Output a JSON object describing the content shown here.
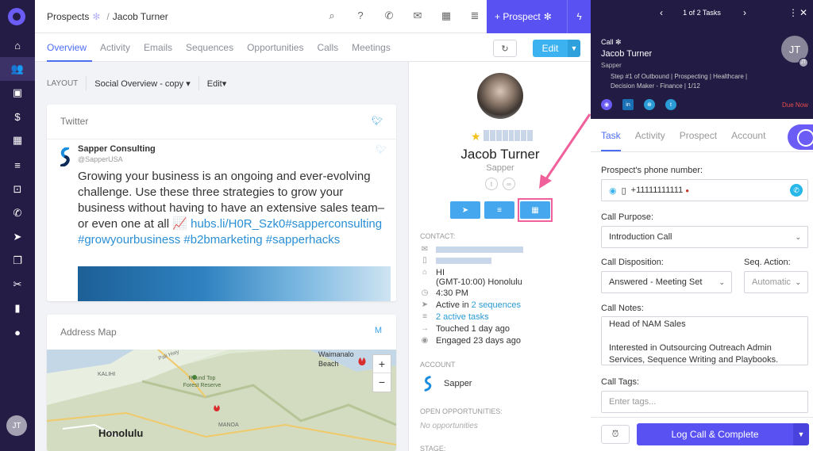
{
  "nav": {
    "avatar_initials": "JT",
    "icons": [
      "home-icon",
      "people-icon",
      "briefcase-icon",
      "dollar-icon",
      "calendar-icon",
      "tasks-icon",
      "inbox-icon",
      "phone-icon",
      "send-icon",
      "copy-icon",
      "scissors-icon",
      "chart-icon",
      "person-icon"
    ]
  },
  "header": {
    "breadcrumb_root": "Prospects",
    "breadcrumb_sep": "/",
    "breadcrumb_current": "Jacob Turner",
    "prospect_button": "+ Prospect"
  },
  "tabs": [
    "Overview",
    "Activity",
    "Emails",
    "Sequences",
    "Opportunities",
    "Calls",
    "Meetings"
  ],
  "toolbar": {
    "edit_label": "Edit"
  },
  "layout_bar": {
    "label": "LAYOUT",
    "selected": "Social Overview - copy",
    "edit": "Edit"
  },
  "twitter_card": {
    "title": "Twitter",
    "account_name": "Sapper Consulting",
    "handle": "@SapperUSA",
    "tweet_text": "Growing your business is an ongoing and ever-evolving challenge. Use these three strategies to grow your business without having to have an extensive sales team– or even one at all 📈",
    "tweet_link": "hubs.li/H0R_Szk0",
    "tweet_hashtags": "#sapperconsulting #growyourbusiness #b2bmarketing #sapperhacks"
  },
  "map_card": {
    "title": "Address Map",
    "badge": "M",
    "city": "Honolulu",
    "labels": [
      "Round Top Forest Reserve",
      "Waimanalo Beach",
      "KALIHI",
      "MANOA",
      "Pali Hwy"
    ]
  },
  "profile": {
    "name": "Jacob Turner",
    "company": "Sapper",
    "contact_label": "CONTACT:",
    "state": "HI",
    "timezone": "(GMT-10:00) Honolulu",
    "local_time": "4:30 PM",
    "active_prefix": "Active in",
    "active_link": "2 sequences",
    "tasks_link": "2 active tasks",
    "touched": "Touched 1 day ago",
    "engaged": "Engaged 23 days ago",
    "account_label": "ACCOUNT",
    "account_name": "Sapper",
    "opps_label": "OPEN OPPORTUNITIES:",
    "opps_value": "No opportunities",
    "stage_label": "STAGE:"
  },
  "task_panel": {
    "count": "1 of 2 Tasks",
    "type": "Call",
    "name": "Jacob Turner",
    "company": "Sapper",
    "step": "Step #1 of Outbound | Prospecting | Healthcare | Decision Maker - Finance | 1/12",
    "avatar": "JT",
    "due": "Due Now",
    "tabs": [
      "Task",
      "Activity",
      "Prospect",
      "Account"
    ],
    "phone_label": "Prospect's phone number:",
    "phone": "+11111111111",
    "purpose_label": "Call Purpose:",
    "purpose": "Introduction Call",
    "disposition_label": "Call Disposition:",
    "disposition": "Answered - Meeting Set",
    "seq_action_label": "Seq. Action:",
    "seq_action": "Automatic",
    "notes_label": "Call Notes:",
    "notes": "Head of NAM Sales\n\nInterested in Outsourcing Outreach Admin Services, Sequence Writing and Playbooks.",
    "tags_label": "Call Tags:",
    "tags_placeholder": "Enter tags...",
    "log_button": "Log Call & Complete"
  },
  "colors": {
    "brand": "#5951f2",
    "nav_bg": "#241c45",
    "link": "#2a9bd6",
    "highlight": "#f0609a"
  }
}
